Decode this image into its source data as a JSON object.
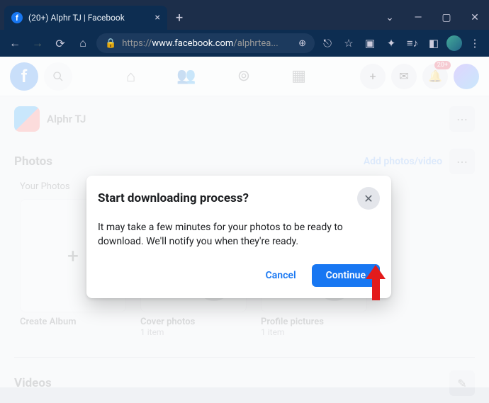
{
  "browser": {
    "tab_title": "(20+) Alphr TJ | Facebook",
    "url_proto": "https://",
    "url_domain": "www.facebook.com",
    "url_path": "/alphrtea..."
  },
  "fb": {
    "profile_name": "Alphr TJ",
    "notif_badge": "20+",
    "photos_heading": "Photos",
    "add_photos_link": "Add photos/video",
    "your_photos_tab": "Your Photos",
    "videos_heading": "Videos",
    "albums": [
      {
        "title": "Create Album",
        "sub": ""
      },
      {
        "title": "Cover photos",
        "sub": "1 item"
      },
      {
        "title": "Profile pictures",
        "sub": "1 item"
      }
    ]
  },
  "modal": {
    "title": "Start downloading process?",
    "body": "It may take a few minutes for your photos to be ready to download. We'll notify you when they're ready.",
    "cancel": "Cancel",
    "continue": "Continue"
  }
}
